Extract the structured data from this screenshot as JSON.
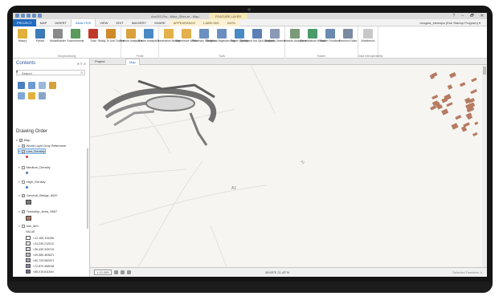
{
  "app": {
    "title": "ArcGIS Pro - Mine_Sites.ar - Map",
    "contextual_tab": "FEATURE LAYER",
    "window_controls": [
      "?",
      "–",
      "🗗",
      "✕"
    ],
    "signin": "douglas_stemaps (Esri Startup Program) ▾"
  },
  "ribbon": {
    "tabs": [
      {
        "label": "PROJECT",
        "kind": "project"
      },
      {
        "label": "MAP",
        "kind": "normal"
      },
      {
        "label": "INSERT",
        "kind": "normal"
      },
      {
        "label": "ANALYSIS",
        "kind": "active"
      },
      {
        "label": "VIEW",
        "kind": "normal"
      },
      {
        "label": "EDIT",
        "kind": "normal"
      },
      {
        "label": "IMAGERY",
        "kind": "normal"
      },
      {
        "label": "SHARE",
        "kind": "normal"
      },
      {
        "label": "APPEARANCE",
        "kind": "ctx"
      },
      {
        "label": "LABELING",
        "kind": "ctx"
      },
      {
        "label": "DATA",
        "kind": "ctx"
      }
    ],
    "groups": [
      {
        "name": "Geoprocessing",
        "buttons": [
          {
            "label": "History",
            "icon": "history-icon",
            "color": "#e2b13c"
          },
          {
            "label": "Python",
            "icon": "python-icon",
            "color": "#3d7ab8"
          },
          {
            "label": "ModelBuilder",
            "icon": "modelbuilder-icon",
            "color": "#8a8a8a"
          },
          {
            "label": "Environments",
            "icon": "environments-icon",
            "color": "#5a9a5a"
          },
          {
            "label": "Tools",
            "icon": "toolbox-icon",
            "color": "#c0392b"
          },
          {
            "label": "Ready To Use Tools ▾",
            "icon": "ready-tools-icon",
            "color": "#d08a2a"
          }
        ]
      },
      {
        "name": "Portal",
        "buttons": [
          {
            "label": "Feature Analysis ▾",
            "icon": "feature-analysis-icon",
            "color": "#d9a13a"
          },
          {
            "label": "Raster Analysis ▾",
            "icon": "raster-analysis-icon",
            "color": "#4a8ac4"
          }
        ]
      },
      {
        "name": "Tools",
        "buttons": [
          {
            "label": "Summarize Nearby",
            "icon": "summarize-nearby-icon",
            "color": "#e3b04b"
          },
          {
            "label": "Summarize Within",
            "icon": "summarize-within-icon",
            "color": "#e3b04b"
          },
          {
            "label": "Summary Statistics",
            "icon": "summary-statistics-icon",
            "color": "#6b8fbf"
          },
          {
            "label": "Empirical Bayesian Krig...",
            "icon": "bayesian-kriging-icon",
            "color": "#6b8fbf"
          },
          {
            "label": "Kernel Density",
            "icon": "kernel-density-icon",
            "color": "#4a8ac4"
          },
          {
            "label": "Optimized Hot Spot Analysis",
            "icon": "hot-spot-icon",
            "color": "#5c7fb5"
          },
          {
            "label": "Similarity Search",
            "icon": "similarity-search-icon",
            "color": "#8a9ab5"
          }
        ]
      },
      {
        "name": "Raster",
        "buttons": [
          {
            "label": "Network Analysis ▾",
            "icon": "network-analysis-icon",
            "color": "#7a9a7a"
          },
          {
            "label": "Geostatistical Wizard",
            "icon": "geostat-wizard-icon",
            "color": "#4a9a6a"
          },
          {
            "label": "Raster Functions",
            "icon": "raster-functions-icon",
            "color": "#6a8ab0"
          },
          {
            "label": "Function Editor",
            "icon": "function-editor-icon",
            "color": "#7a8aa0"
          }
        ]
      },
      {
        "name": "Data Interoperability",
        "buttons": [
          {
            "label": "Workbench",
            "icon": "workbench-icon",
            "color": "#c8c8c8"
          }
        ]
      }
    ]
  },
  "contents": {
    "title": "Contents",
    "controls": "▾ ⊓ ✕",
    "search_placeholder": "Search",
    "drawing_order": "Drawing Order",
    "layers": [
      {
        "name": "Map",
        "checked": true,
        "expanded": true,
        "indent": 0
      },
      {
        "name": "World Light Gray Reference",
        "checked": true,
        "expanded": false,
        "indent": 1
      },
      {
        "name": "Low_Density",
        "checked": true,
        "expanded": true,
        "indent": 1,
        "selected": true
      },
      {
        "name": "Medium_Density",
        "checked": false,
        "expanded": true,
        "indent": 1
      },
      {
        "name": "High_Density",
        "checked": false,
        "expanded": true,
        "indent": 1
      },
      {
        "name": "General_Bridge_5657",
        "checked": true,
        "expanded": true,
        "indent": 1
      },
      {
        "name": "Township_Area_5657",
        "checked": true,
        "expanded": true,
        "indent": 1
      },
      {
        "name": "low_den",
        "checked": false,
        "expanded": true,
        "indent": 1
      }
    ],
    "legend_title": "VALUE",
    "legend_items": [
      "<12,165.116496",
      "<24,230.212012",
      "<36,435.349219",
      "<49,580.463621",
      "<60,725.582021",
      "<72,870.458048",
      "<85,015.811604"
    ],
    "legend_colors": [
      "#ffffff",
      "#e9e9f0",
      "#d6d4e4",
      "#bfbad4",
      "#a49fc0",
      "#8b83aa",
      "#6e6592"
    ]
  },
  "map_view": {
    "tabs": [
      "Project",
      "Map"
    ],
    "active_tab": "Map",
    "scale": "1:12,095",
    "coordinates": "38.65°E 21.42°N",
    "selected_features": "Selected Features: 0",
    "parcel_color": "#b67a62",
    "road_label_1": "A1",
    "road_label_2": "A1"
  }
}
